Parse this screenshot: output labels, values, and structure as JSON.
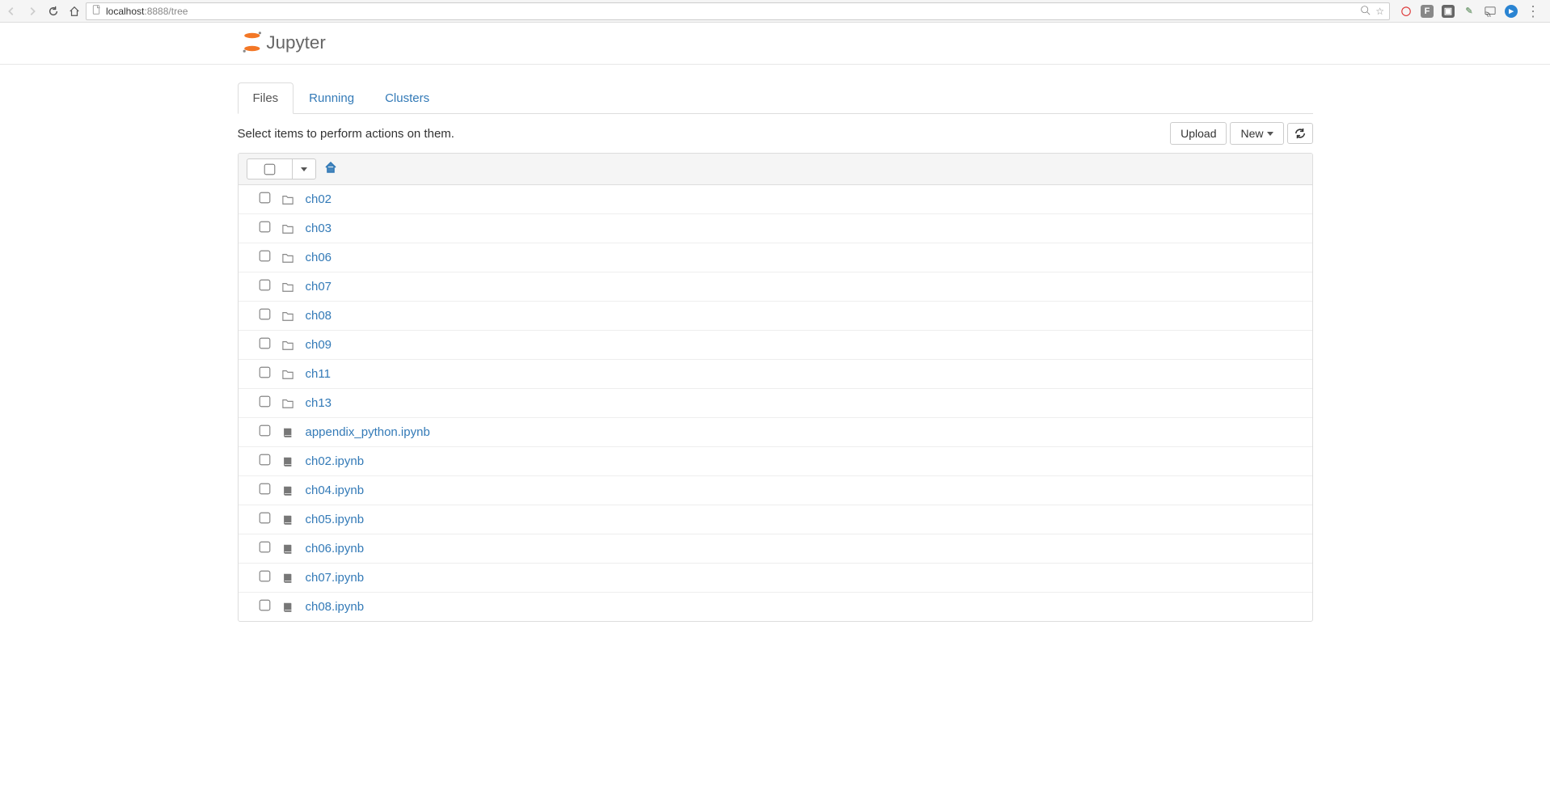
{
  "browser": {
    "url_host": "localhost",
    "url_rest": ":8888/tree"
  },
  "tabs": [
    {
      "label": "Files",
      "active": true
    },
    {
      "label": "Running",
      "active": false
    },
    {
      "label": "Clusters",
      "active": false
    }
  ],
  "toolbar": {
    "hint": "Select items to perform actions on them.",
    "upload_label": "Upload",
    "new_label": "New"
  },
  "items": [
    {
      "type": "folder",
      "name": "ch02"
    },
    {
      "type": "folder",
      "name": "ch03"
    },
    {
      "type": "folder",
      "name": "ch06"
    },
    {
      "type": "folder",
      "name": "ch07"
    },
    {
      "type": "folder",
      "name": "ch08"
    },
    {
      "type": "folder",
      "name": "ch09"
    },
    {
      "type": "folder",
      "name": "ch11"
    },
    {
      "type": "folder",
      "name": "ch13"
    },
    {
      "type": "notebook",
      "name": "appendix_python.ipynb"
    },
    {
      "type": "notebook",
      "name": "ch02.ipynb"
    },
    {
      "type": "notebook",
      "name": "ch04.ipynb"
    },
    {
      "type": "notebook",
      "name": "ch05.ipynb"
    },
    {
      "type": "notebook",
      "name": "ch06.ipynb"
    },
    {
      "type": "notebook",
      "name": "ch07.ipynb"
    },
    {
      "type": "notebook",
      "name": "ch08.ipynb"
    }
  ]
}
